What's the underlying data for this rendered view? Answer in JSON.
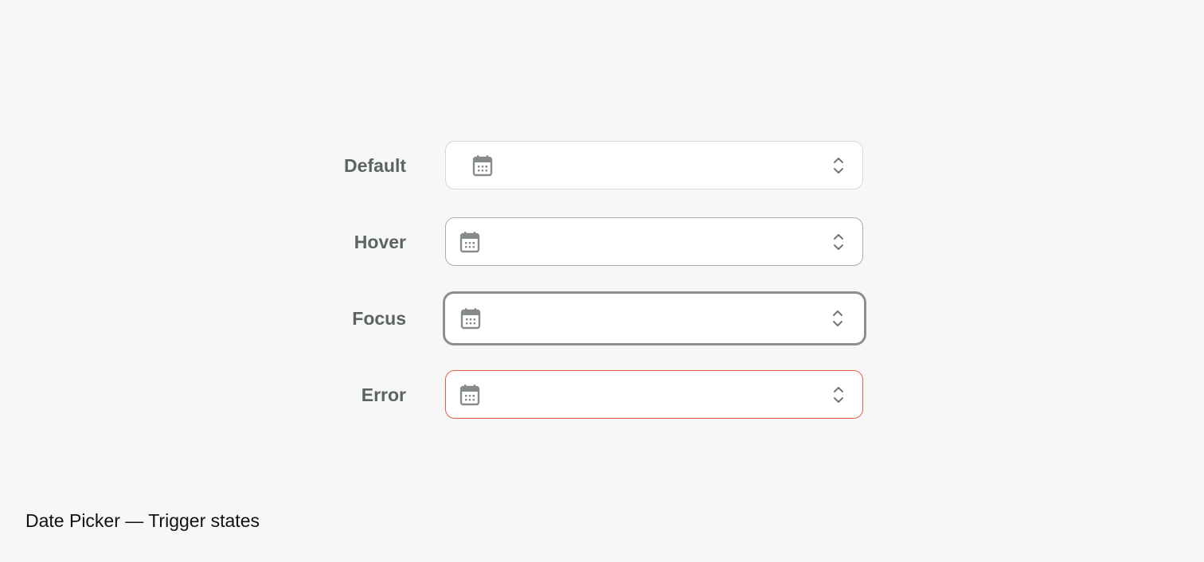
{
  "states": [
    {
      "label": "Default",
      "variant": "default",
      "border_color": "#d6d9d7"
    },
    {
      "label": "Hover",
      "variant": "hover",
      "border_color": "#a9aeab"
    },
    {
      "label": "Focus",
      "variant": "focus",
      "border_color": "#8a918d"
    },
    {
      "label": "Error",
      "variant": "error",
      "border_color": "#e25c48"
    }
  ],
  "icons": {
    "leading": "calendar-icon",
    "trailing": "chevron-up-down-icon"
  },
  "colors": {
    "background": "#f6f7f6",
    "label_text": "#5c6460",
    "icon": "#858b87",
    "error": "#e25c48"
  },
  "caption": "Date Picker — Trigger states"
}
